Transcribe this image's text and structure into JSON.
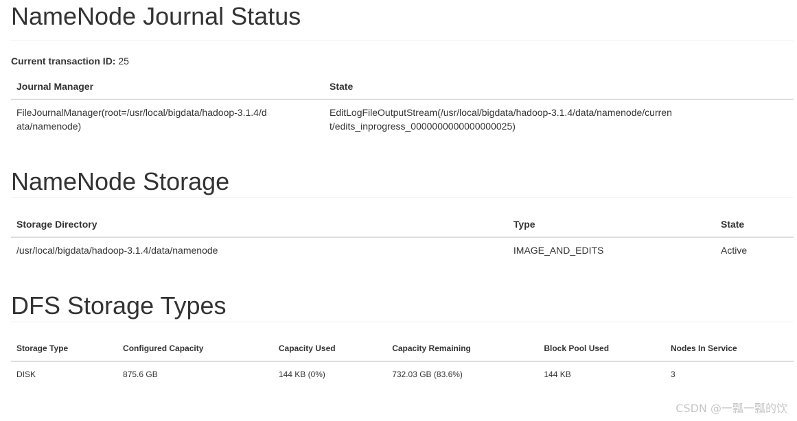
{
  "journal": {
    "title": "NameNode Journal Status",
    "txid_label": "Current transaction ID:",
    "txid_value": "25",
    "headers": [
      "Journal Manager",
      "State"
    ],
    "rows": [
      [
        "FileJournalManager(root=/usr/local/bigdata/hadoop-3.1.4/data/namenode)",
        "EditLogFileOutputStream(/usr/local/bigdata/hadoop-3.1.4/data/namenode/current/edits_inprogress_0000000000000000025)"
      ]
    ]
  },
  "storage": {
    "title": "NameNode Storage",
    "headers": [
      "Storage Directory",
      "Type",
      "State"
    ],
    "rows": [
      [
        "/usr/local/bigdata/hadoop-3.1.4/data/namenode",
        "IMAGE_AND_EDITS",
        "Active"
      ]
    ]
  },
  "dfs": {
    "title": "DFS Storage Types",
    "headers": [
      "Storage Type",
      "Configured Capacity",
      "Capacity Used",
      "Capacity Remaining",
      "Block Pool Used",
      "Nodes In Service"
    ],
    "rows": [
      [
        "DISK",
        "875.6 GB",
        "144 KB (0%)",
        "732.03 GB (83.6%)",
        "144 KB",
        "3"
      ]
    ]
  },
  "watermark": "CSDN @一瓢一瓢的饮"
}
